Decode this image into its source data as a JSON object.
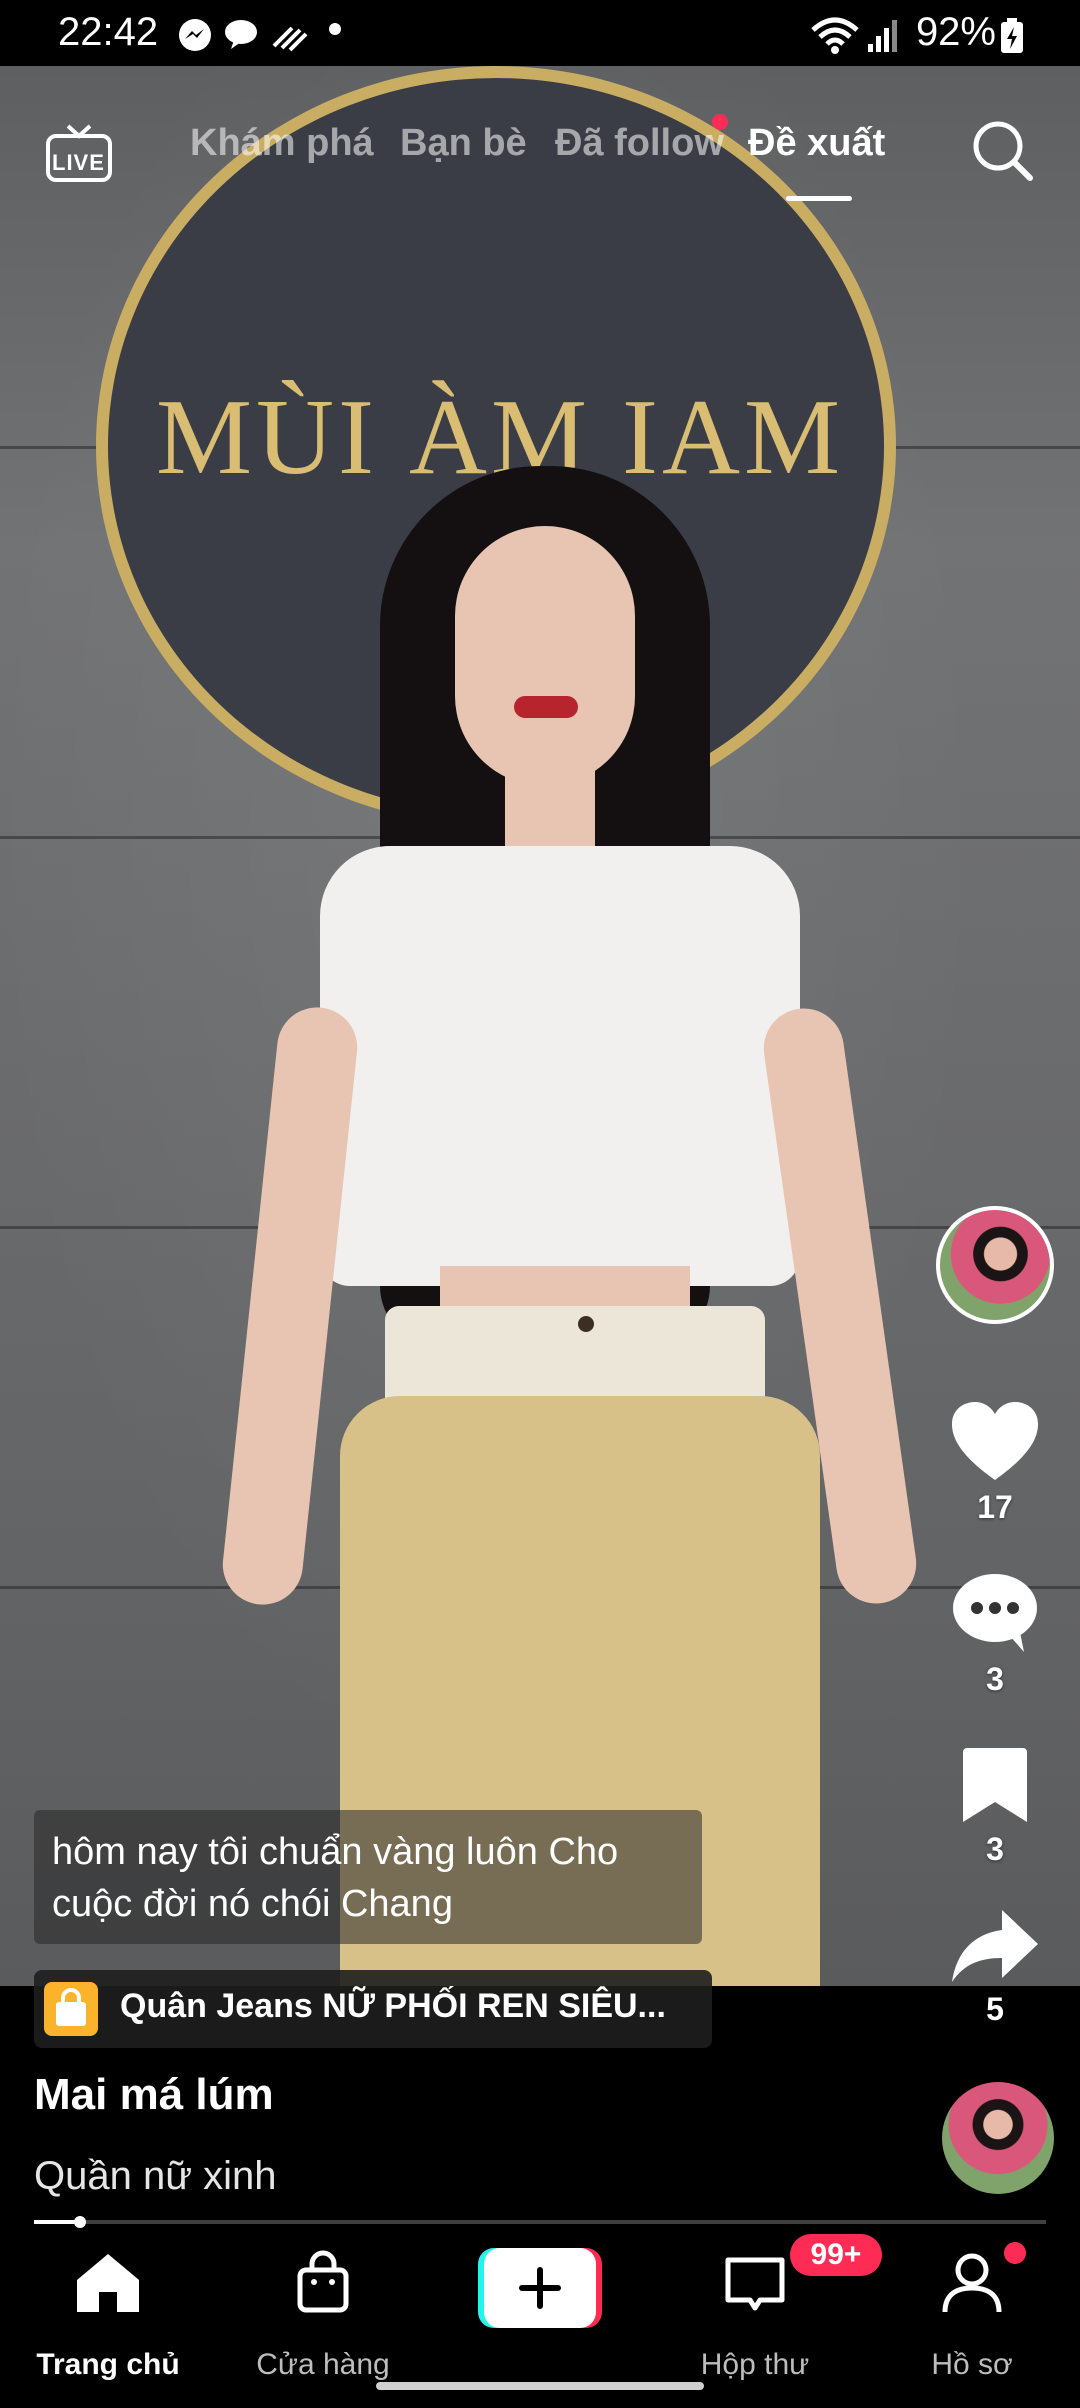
{
  "status_bar": {
    "time": "22:42",
    "battery": "92%"
  },
  "video": {
    "sign_text": "MÙI ÀM IAM"
  },
  "top_nav": {
    "live_label": "LIVE",
    "tabs": [
      {
        "label": "Khám phá"
      },
      {
        "label": "Bạn bè"
      },
      {
        "label": "Đã follow"
      },
      {
        "label": "Đề xuất"
      }
    ],
    "active_tab": "Đề xuất"
  },
  "actions": {
    "likes": "17",
    "comments": "3",
    "saves": "3",
    "shares": "5"
  },
  "caption": "hôm nay tôi chuẩn vàng luôn Cho cuộc đời nó chói Chang",
  "product": {
    "title": "Quân Jeans NỮ PHỐI REN SIÊU..."
  },
  "author": {
    "name": "Mai má lúm",
    "description": "Quần nữ xinh"
  },
  "progress": {
    "fraction": 0.045
  },
  "bottom_nav": {
    "items": [
      {
        "label": "Trang chủ",
        "icon": "home-icon"
      },
      {
        "label": "Cửa hàng",
        "icon": "shop-bag-icon"
      },
      {
        "label": "",
        "icon": "plus-icon"
      },
      {
        "label": "Hộp thư",
        "icon": "inbox-icon"
      },
      {
        "label": "Hồ sơ",
        "icon": "profile-icon"
      }
    ],
    "inbox_badge": "99+"
  },
  "colors": {
    "accent": "#fe2c55",
    "cyan": "#25f4ee",
    "gold": "#c9ad63",
    "product_icon": "#fbb32c"
  }
}
